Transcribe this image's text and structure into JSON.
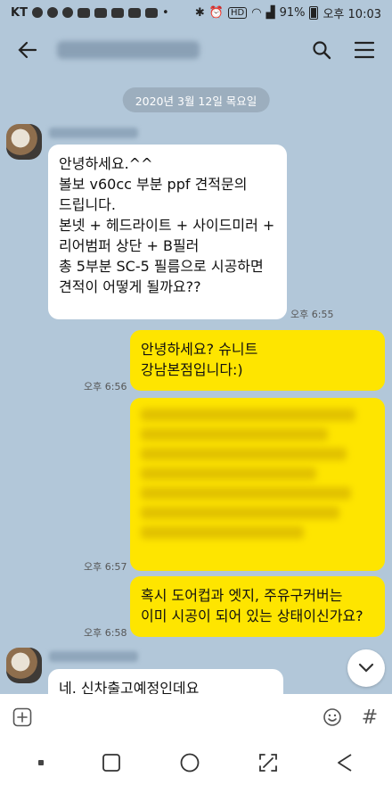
{
  "status_bar": {
    "carrier": "KT",
    "battery": "91%",
    "time": "오후 10:03"
  },
  "header": {
    "back_icon": "arrow-left-icon",
    "search_icon": "search-icon",
    "menu_icon": "hamburger-icon"
  },
  "date_divider": "2020년 3월 12일 목요일",
  "messages": [
    {
      "side": "in",
      "text": "안녕하세요.^^\n볼보 v60cc 부분 ppf 견적문의\n드립니다.\n본넷 + 헤드라이트 + 사이드미러 +\n리어범퍼 상단 + B필러\n총 5부분 SC-5 필름으로 시공하면\n견적이 어떻게 될까요??",
      "time": "오후 6:55"
    },
    {
      "side": "out",
      "text": "안녕하세요? 슈니트\n강남본점입니다:)",
      "time": "오후 6:56"
    },
    {
      "side": "out",
      "blurred": true,
      "time": "오후 6:57"
    },
    {
      "side": "out",
      "text": "혹시 도어컵과 엣지, 주유구커버는\n이미 시공이 되어 있는 상태이신가요?",
      "time": "오후 6:58"
    },
    {
      "side": "in",
      "text": "네. 신차출고예정인데요"
    }
  ],
  "input": {
    "value": "",
    "placeholder": ""
  },
  "input_icons": {
    "add": "plus-square-icon",
    "emoji": "smile-icon",
    "hash": "#"
  }
}
